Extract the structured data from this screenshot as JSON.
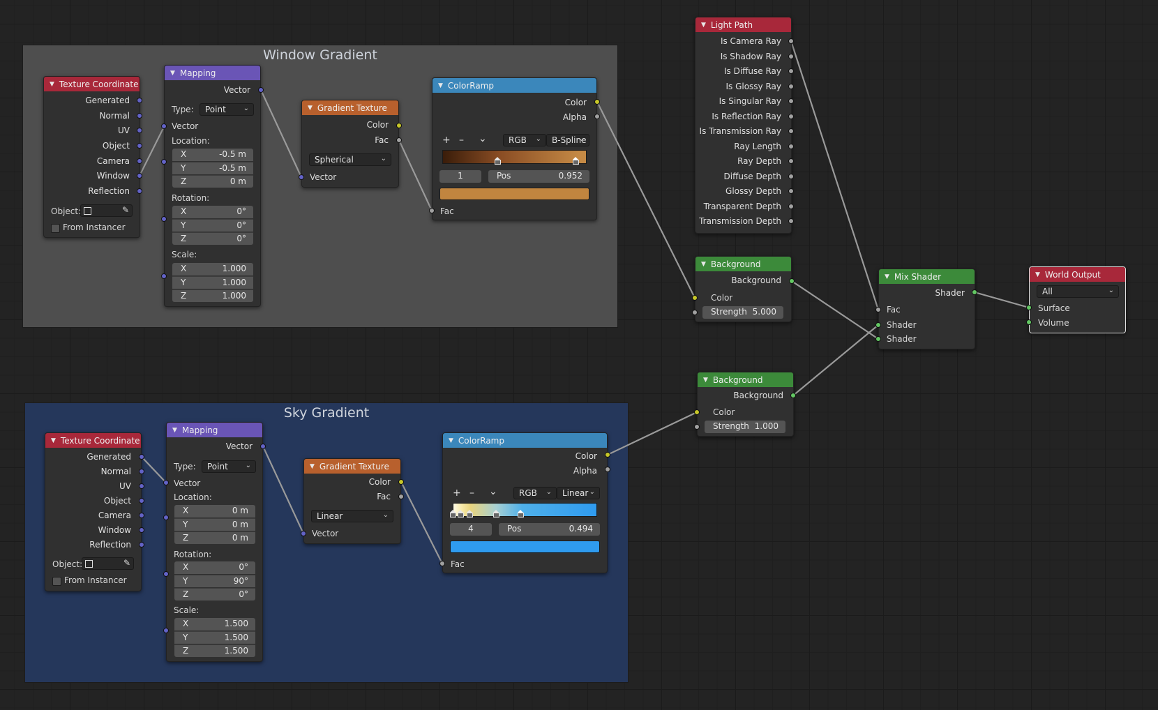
{
  "colors": {
    "wire": "#9a9a9a",
    "canvas": "#232323",
    "frame_window": "#525252",
    "frame_sky": "#25385e"
  },
  "frames": {
    "window_title": "Window Gradient",
    "sky_title": "Sky Gradient"
  },
  "w_texcoord": {
    "title": "Texture Coordinate",
    "outputs": [
      "Generated",
      "Normal",
      "UV",
      "Object",
      "Camera",
      "Window",
      "Reflection"
    ],
    "object_label": "Object:",
    "from_instancer": "From Instancer"
  },
  "w_mapping": {
    "title": "Mapping",
    "output": "Vector",
    "type_label": "Type:",
    "type_value": "Point",
    "vector_input": "Vector",
    "location_label": "Location:",
    "location": {
      "x": "-0.5 m",
      "y": "-0.5 m",
      "z": "0 m"
    },
    "rotation_label": "Rotation:",
    "rotation": {
      "x": "0°",
      "y": "0°",
      "z": "0°"
    },
    "scale_label": "Scale:",
    "scale": {
      "x": "1.000",
      "y": "1.000",
      "z": "1.000"
    },
    "axes": [
      "X",
      "Y",
      "Z"
    ]
  },
  "w_gradient": {
    "title": "Gradient Texture",
    "out_color": "Color",
    "out_fac": "Fac",
    "type": "Spherical",
    "in_vector": "Vector"
  },
  "w_ramp": {
    "title": "ColorRamp",
    "out_color": "Color",
    "out_alpha": "Alpha",
    "color_mode": "RGB",
    "interpolation": "B-Spline",
    "index": "1",
    "pos_label": "Pos",
    "pos": "0.952",
    "in_fac": "Fac",
    "swatch_color": "#c1853f",
    "plus": "+",
    "minus": "–",
    "menu": "⌄"
  },
  "s_texcoord": {
    "title": "Texture Coordinate",
    "outputs": [
      "Generated",
      "Normal",
      "UV",
      "Object",
      "Camera",
      "Window",
      "Reflection"
    ],
    "object_label": "Object:",
    "from_instancer": "From Instancer"
  },
  "s_mapping": {
    "title": "Mapping",
    "output": "Vector",
    "type_label": "Type:",
    "type_value": "Point",
    "vector_input": "Vector",
    "location_label": "Location:",
    "location": {
      "x": "0 m",
      "y": "0 m",
      "z": "0 m"
    },
    "rotation_label": "Rotation:",
    "rotation": {
      "x": "0°",
      "y": "90°",
      "z": "0°"
    },
    "scale_label": "Scale:",
    "scale": {
      "x": "1.500",
      "y": "1.500",
      "z": "1.500"
    },
    "axes": [
      "X",
      "Y",
      "Z"
    ]
  },
  "s_gradient": {
    "title": "Gradient Texture",
    "out_color": "Color",
    "out_fac": "Fac",
    "type": "Linear",
    "in_vector": "Vector"
  },
  "s_ramp": {
    "title": "ColorRamp",
    "out_color": "Color",
    "out_alpha": "Alpha",
    "color_mode": "RGB",
    "interpolation": "Linear",
    "index": "4",
    "pos_label": "Pos",
    "pos": "0.494",
    "in_fac": "Fac",
    "swatch_color": "#2f9bef",
    "plus": "+",
    "minus": "–",
    "menu": "⌄"
  },
  "light_path": {
    "title": "Light Path",
    "outputs": [
      "Is Camera Ray",
      "Is Shadow Ray",
      "Is Diffuse Ray",
      "Is Glossy Ray",
      "Is Singular Ray",
      "Is Reflection Ray",
      "Is Transmission Ray",
      "Ray Length",
      "Ray Depth",
      "Diffuse Depth",
      "Glossy Depth",
      "Transparent Depth",
      "Transmission Depth"
    ]
  },
  "bg1": {
    "title": "Background",
    "output": "Background",
    "in_color": "Color",
    "strength_label": "Strength",
    "strength": "5.000"
  },
  "bg2": {
    "title": "Background",
    "output": "Background",
    "in_color": "Color",
    "strength_label": "Strength",
    "strength": "1.000"
  },
  "mix": {
    "title": "Mix Shader",
    "output": "Shader",
    "in_fac": "Fac",
    "in_shader1": "Shader",
    "in_shader2": "Shader"
  },
  "world_output": {
    "title": "World Output",
    "target": "All",
    "in_surface": "Surface",
    "in_volume": "Volume"
  }
}
